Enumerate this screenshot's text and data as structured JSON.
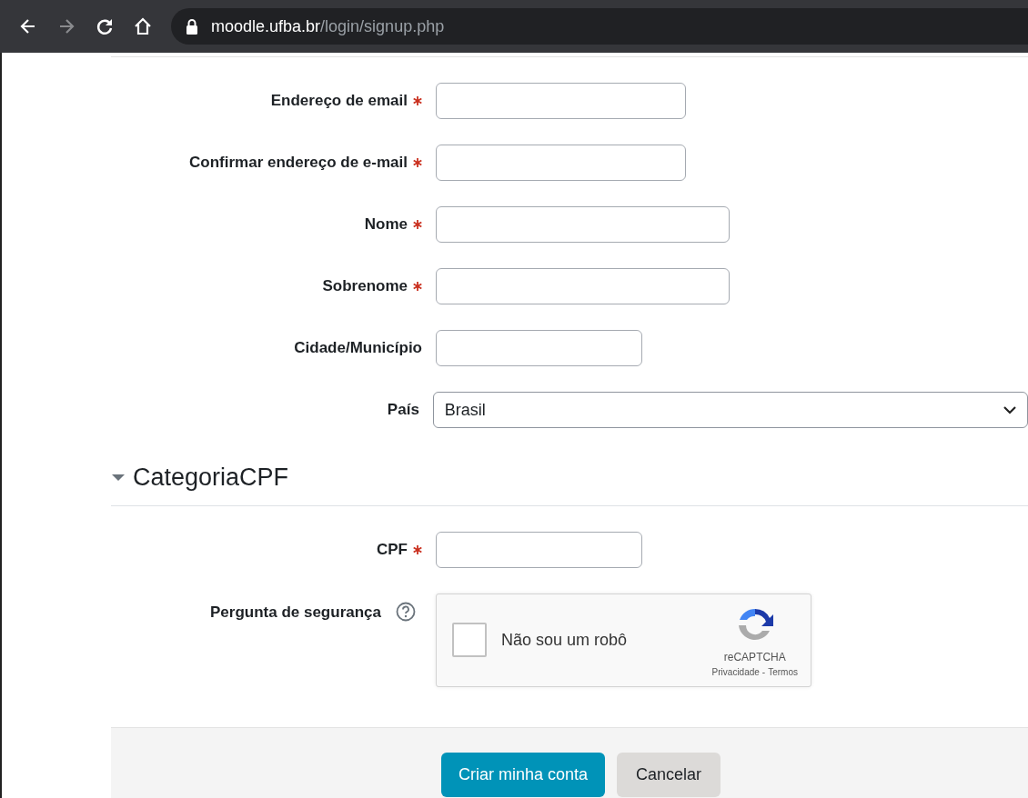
{
  "browser": {
    "url_host": "moodle.ufba.br",
    "url_path": "/login/signup.php"
  },
  "fields": [
    {
      "label": "Endereço de email",
      "required": true,
      "kind": "text"
    },
    {
      "label": "Confirmar endereço de e-mail",
      "required": true,
      "kind": "text"
    },
    {
      "label": "Nome",
      "required": true,
      "kind": "text"
    },
    {
      "label": "Sobrenome",
      "required": true,
      "kind": "text"
    },
    {
      "label": "Cidade/Município",
      "required": false,
      "kind": "text"
    },
    {
      "label": "País",
      "required": false,
      "kind": "select",
      "value": "Brasil"
    }
  ],
  "section": {
    "title": "CategoriaCPF",
    "expanded": true
  },
  "section_fields": [
    {
      "label": "CPF",
      "required": true,
      "kind": "text"
    }
  ],
  "captcha": {
    "label": "Pergunta de segurança",
    "checkbox_label": "Não sou um robô",
    "checked": false,
    "brand": "reCAPTCHA",
    "links": [
      "Privacidade",
      "Termos"
    ],
    "separator": "-"
  },
  "buttons": [
    {
      "label": "Criar minha conta",
      "kind": "primary"
    },
    {
      "label": "Cancelar",
      "kind": "secondary"
    }
  ]
}
